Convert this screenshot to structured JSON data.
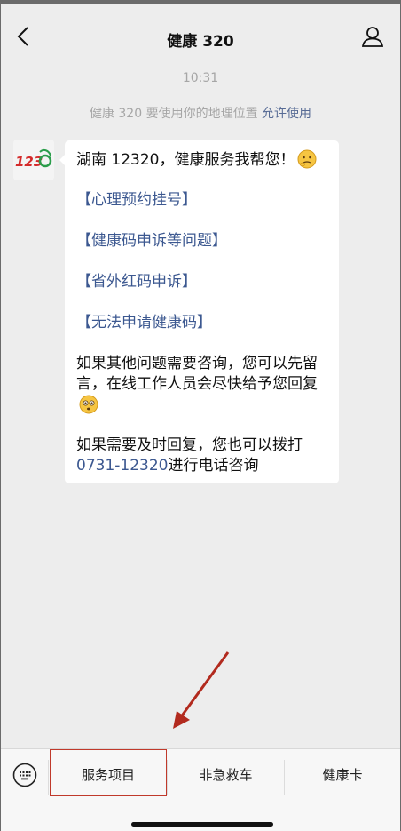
{
  "header": {
    "title": "健康 320",
    "back_icon": "chevron-left-icon",
    "profile_icon": "user-icon"
  },
  "chat": {
    "timestamp": "10:31",
    "system_notice": {
      "text": "健康 320 要使用你的地理位置",
      "action": "允许使用"
    },
    "avatar_label": "12320",
    "message": {
      "greeting": "湖南 12320，健康服务我帮您！",
      "menu_links": [
        "【心理预约挂号】",
        "【健康码申诉等问题】",
        "【省外红码申诉】",
        "【无法申请健康码】"
      ],
      "para1": "如果其他问题需要咨询，您可以先留言，在线工作人员会尽快给予您回复",
      "para2_prefix": "如果需要及时回复，您也可以拨打",
      "phone": "0731-12320",
      "para2_suffix": "进行电话咨询"
    }
  },
  "bottom_menu": {
    "keyboard_icon": "keyboard-icon",
    "items": [
      "服务项目",
      "非急救车",
      "健康卡"
    ]
  },
  "colors": {
    "link": "#3c5890",
    "highlight_box": "#c0392b",
    "arrow": "#b22a1e",
    "background": "#ededed"
  }
}
